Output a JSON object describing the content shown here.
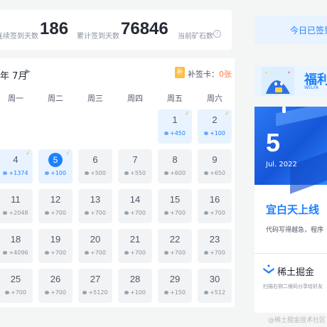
{
  "stats": {
    "streak_label": "连续签到天数",
    "streak_value": "186",
    "total_label": "累计签到天数",
    "total_value": "76846",
    "ore_label": "当前矿石数",
    "info_icon": "info-icon"
  },
  "calendar": {
    "month_label": "年 7月",
    "next_icon": "▶",
    "card_icon": "补",
    "card_label": "补签卡：",
    "card_count": "0张",
    "weekdays": [
      "周一",
      "周二",
      "周三",
      "周四",
      "周五",
      "周六"
    ],
    "days": [
      {
        "day": "1",
        "points": "+450",
        "done": true
      },
      {
        "day": "2",
        "points": "+100",
        "done": true
      },
      {
        "day": "4",
        "points": "+1374",
        "done": true
      },
      {
        "day": "5",
        "points": "+100",
        "done": true,
        "today": true
      },
      {
        "day": "6",
        "points": "+500"
      },
      {
        "day": "7",
        "points": "+550"
      },
      {
        "day": "8",
        "points": "+600"
      },
      {
        "day": "9",
        "points": "+650"
      },
      {
        "day": "11",
        "points": "+2048"
      },
      {
        "day": "12",
        "points": "+700"
      },
      {
        "day": "13",
        "points": "+700"
      },
      {
        "day": "14",
        "points": "+700"
      },
      {
        "day": "15",
        "points": "+700"
      },
      {
        "day": "16",
        "points": "+700"
      },
      {
        "day": "18",
        "points": "+4096"
      },
      {
        "day": "19",
        "points": "+700"
      },
      {
        "day": "20",
        "points": "+700"
      },
      {
        "day": "21",
        "points": "+700"
      },
      {
        "day": "22",
        "points": "+700"
      },
      {
        "day": "23",
        "points": "+700"
      },
      {
        "day": "25",
        "points": "+700"
      },
      {
        "day": "26",
        "points": "+700"
      },
      {
        "day": "27",
        "points": "+5120"
      },
      {
        "day": "28",
        "points": "+100"
      },
      {
        "day": "29",
        "points": "+150"
      },
      {
        "day": "30",
        "points": "+512"
      }
    ]
  },
  "sidebar": {
    "signed_button": "今日已签到",
    "banner_title": "福利",
    "banner_sub": "WELFA",
    "poster_day": "5",
    "poster_month": "Jul. 2022",
    "poster_quote": "宜白天上线",
    "poster_sub": "代码写得越急，程序",
    "brand": "稀土掘金",
    "scan_text": "扫描右侧二维码分享给好友"
  },
  "watermark": "@稀土掘金技术社区",
  "colors": {
    "accent": "#1e80ff",
    "check": "#f5a623",
    "card": "#fbbf47"
  }
}
